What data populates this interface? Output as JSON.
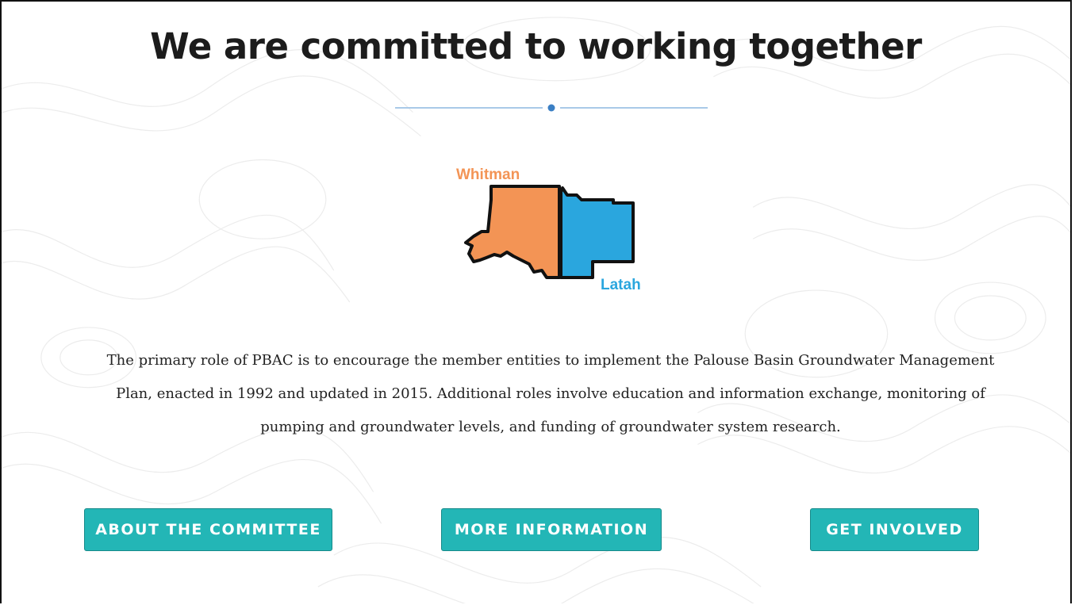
{
  "section": {
    "title": "We are committed to working together",
    "description": "The primary role of PBAC is to encourage the member entities to implement the Palouse Basin Groundwater Management Plan, enacted in 1992 and updated in 2015. Additional roles involve education and information exchange, monitoring of pumping and groundwater levels, and funding of groundwater system research."
  },
  "map": {
    "west_county": "Whitman",
    "east_county": "Latah",
    "west_color": "#f39455",
    "east_color": "#2aa6de"
  },
  "buttons": {
    "about": "ABOUT THE COMMITTEE",
    "info": "MORE INFORMATION",
    "involved": "GET INVOLVED"
  },
  "colors": {
    "button": "#23b6b6",
    "divider": "#a9c9e8",
    "divider_dot": "#3b7fc4"
  }
}
